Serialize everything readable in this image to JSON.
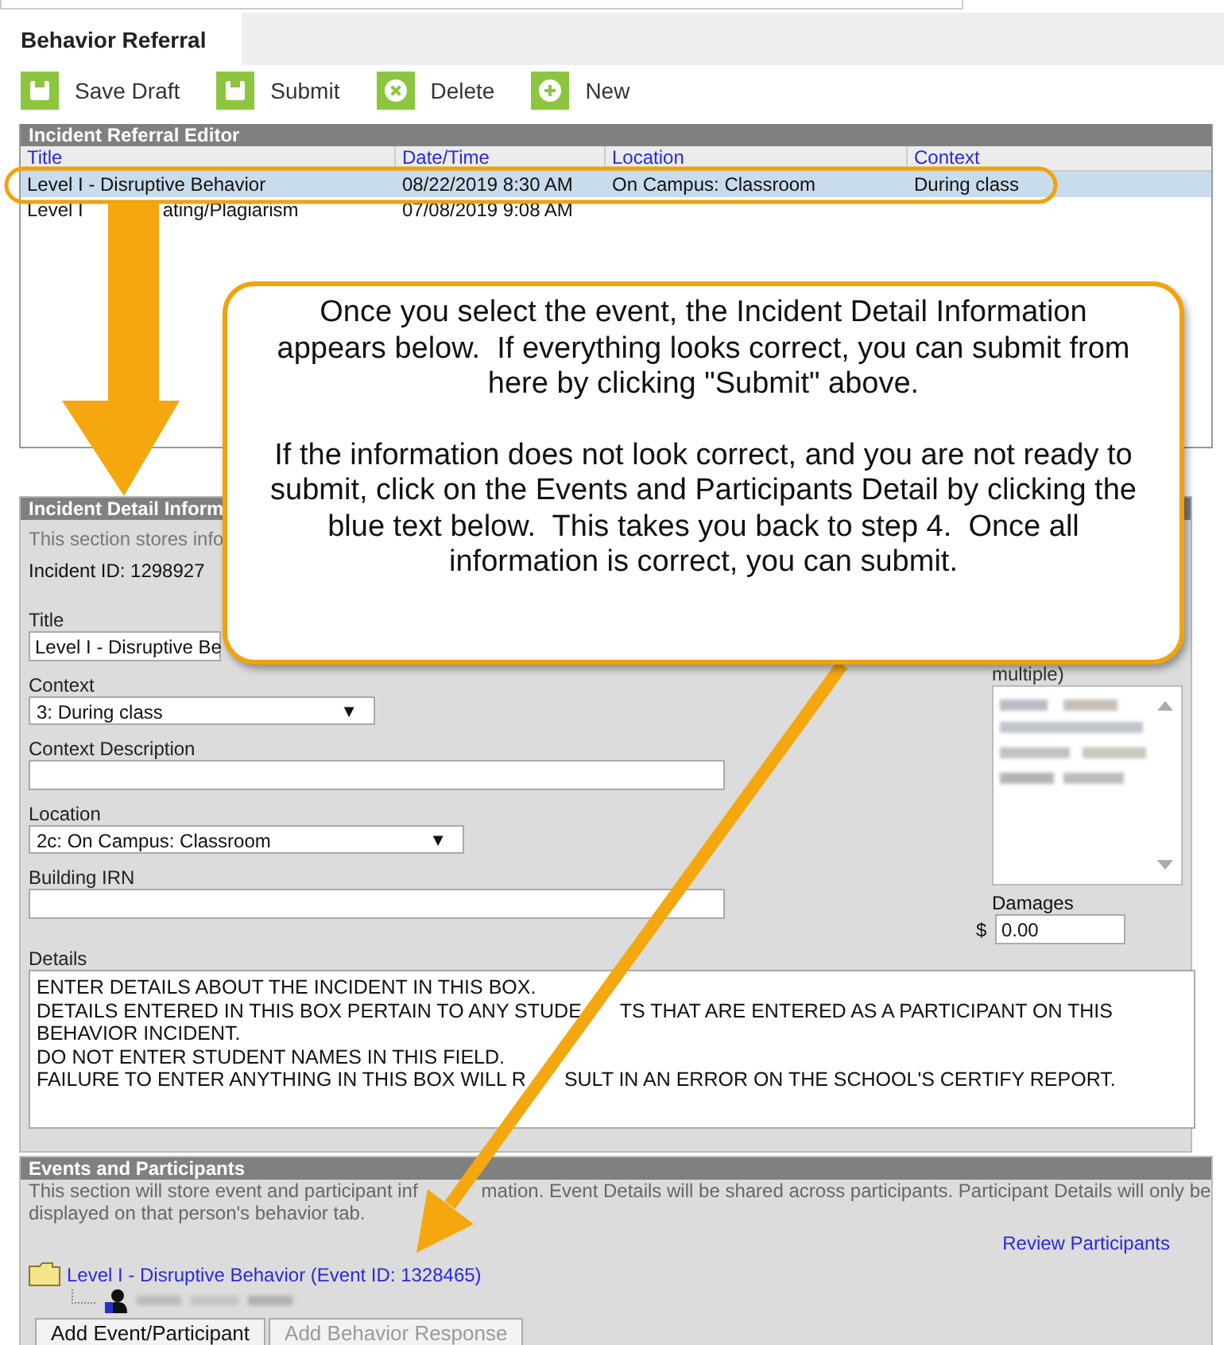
{
  "tabs": [
    {
      "label": "Behavior Referral",
      "selected": true
    }
  ],
  "toolbar": [
    {
      "kind": "save",
      "label": "Save Draft"
    },
    {
      "kind": "save",
      "label": "Submit"
    },
    {
      "kind": "delete",
      "label": "Delete"
    },
    {
      "kind": "new",
      "label": "New"
    }
  ],
  "referral_editor": {
    "title": "Incident Referral Editor",
    "columns": [
      "Title",
      "Date/Time",
      "Location",
      "Context"
    ],
    "rows": [
      {
        "selected": true,
        "title_parts": [
          "Level I - Disruptive Behavior"
        ],
        "date_time": "08/22/2019 8:30 AM",
        "location": "On Campus: Classroom",
        "context": "During class"
      },
      {
        "selected": false,
        "title_parts": [
          "Level I",
          "ating/Plagiarism"
        ],
        "date_time": "07/08/2019 9:08 AM"
      }
    ]
  },
  "incident_detail": {
    "title": "Incident Detail Inform",
    "description": "This section stores info",
    "incident_id": "Incident ID: 1298927",
    "fields": [
      {
        "kind": "text",
        "label": "Title",
        "value": "Level I - Disruptive Be"
      },
      {
        "kind": "select",
        "label": "Context",
        "value": "3: During class",
        "arrow": "▼"
      },
      {
        "kind": "text",
        "label": "Context Description"
      },
      {
        "kind": "select",
        "label": "Location",
        "value": "2c: On Campus: Classroom",
        "arrow": "▼"
      },
      {
        "kind": "text",
        "label": "Building IRN"
      }
    ],
    "list_label": "multiple)",
    "damages": {
      "label": "Damages",
      "currency": "$",
      "value": "0.00"
    },
    "details": {
      "label": "Details",
      "lines": [
        [
          "ENTER DETAILS ABOUT THE INCIDENT IN THIS BOX."
        ],
        [
          "DETAILS ENTERED IN THIS BOX PERTAIN TO ANY STUDE",
          "TS THAT ARE ENTERED AS A PARTICIPANT ON THIS"
        ],
        [
          "BEHAVIOR INCIDENT."
        ],
        [
          "DO NOT ENTER STUDENT NAMES IN THIS FIELD."
        ],
        [
          "FAILURE TO ENTER ANYTHING IN THIS BOX WILL R",
          "SULT IN AN ERROR ON THE SCHOOL'S CERTIFY REPORT."
        ]
      ]
    }
  },
  "events": {
    "title": "Events and Participants",
    "description_lines": [
      [
        "This section will store event and participant inf",
        "mation. Event Details will be shared across participants. Participant Details will only be"
      ],
      [
        "displayed on that person's behavior tab."
      ]
    ],
    "review_link": "Review Participants",
    "event_link": "Level I - Disruptive Behavior (Event ID: 1328465)",
    "buttons": [
      {
        "label": "Add Event/Participant",
        "disabled": false
      },
      {
        "label": "Add Behavior Response",
        "disabled": true
      }
    ]
  },
  "callout": {
    "paragraphs": [
      "Once you select the event, the Incident Detail Information appears below.  If everything looks correct, you can submit from here by clicking \"Submit\" above.",
      "If the information does not look correct, and you are not ready to submit, click on the Events and Participants Detail by clicking the blue text below.  This takes you back to step 4.  Once all information is correct, you can submit."
    ]
  }
}
